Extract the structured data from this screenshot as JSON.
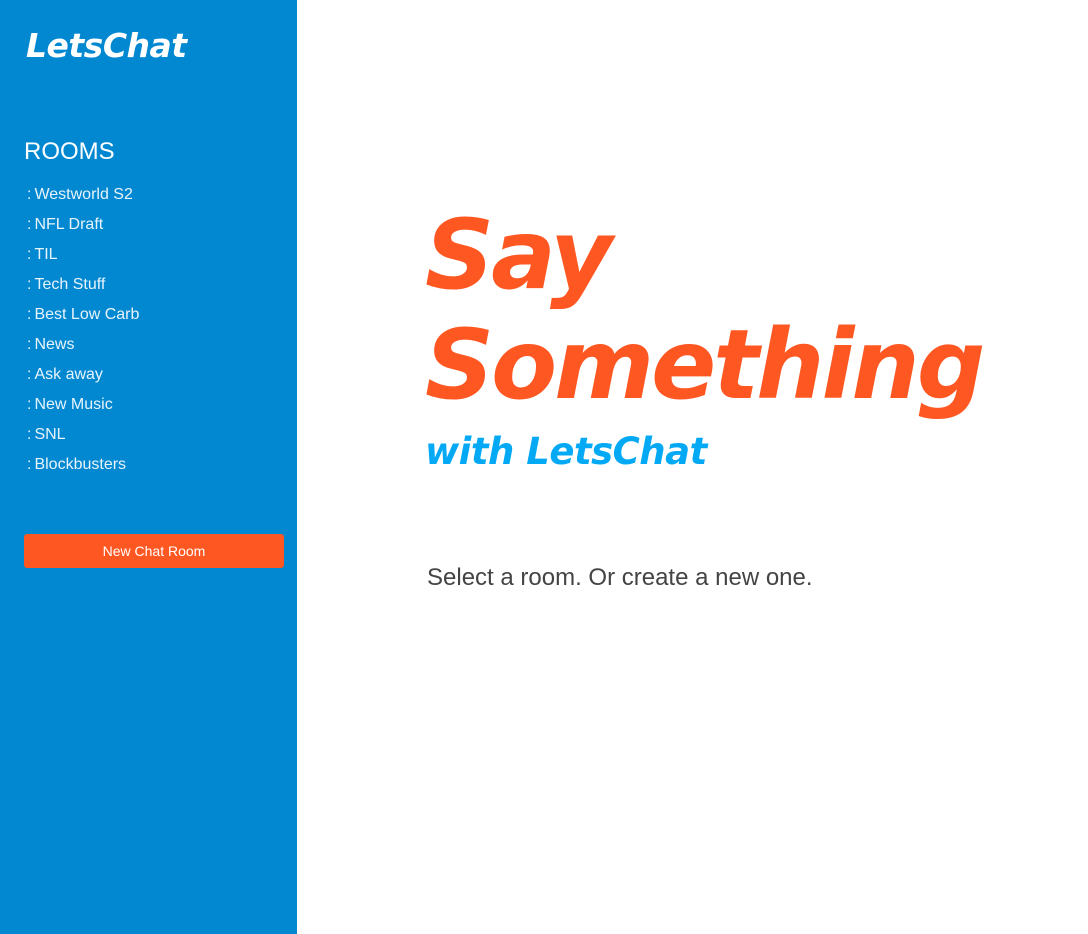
{
  "colors": {
    "sidebar_bg": "#0288d1",
    "accent": "#ff5722",
    "brand_blue": "#03a9f4",
    "text_dark": "#444444"
  },
  "sidebar": {
    "brand": "LetsChat",
    "rooms_heading": "ROOMS",
    "room_prefix": ":",
    "rooms": [
      "Westworld S2",
      "NFL Draft",
      "TIL",
      "Tech Stuff",
      "Best Low Carb",
      "News",
      "Ask away",
      "New Music",
      "SNL",
      "Blockbusters"
    ],
    "new_room_button": "New Chat Room"
  },
  "main": {
    "title_line1": "Say",
    "title_line2": "Something",
    "subtitle": "with LetsChat",
    "hint": "Select a room. Or create a new one."
  }
}
